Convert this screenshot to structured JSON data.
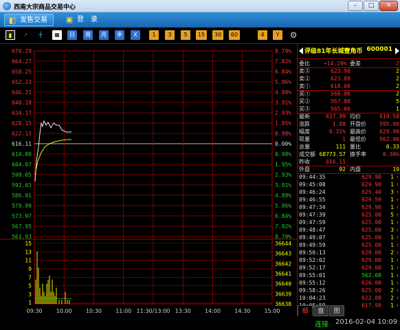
{
  "window": {
    "title": "西南大宗商品交易中心",
    "min": "–",
    "max": "□",
    "close": "✕"
  },
  "menu": [
    {
      "label": "发售交易",
      "icon": "🖥",
      "active": true
    },
    {
      "label": "登　录",
      "icon": "🔒",
      "active": false
    }
  ],
  "toolbar": {
    "period_buttons": [
      "日",
      "周",
      "月",
      "季",
      "X"
    ],
    "minute_buttons": [
      "1",
      "3",
      "5",
      "15",
      "30",
      "60",
      "4",
      "Y"
    ],
    "settings_icon": "gear-icon"
  },
  "chart": {
    "prices": [
      "670.29",
      "664.27",
      "658.25",
      "652.23",
      "646.21",
      "640.19",
      "634.17",
      "628.15",
      "622.13",
      "616.11",
      "610.09",
      "604.07",
      "598.05",
      "592.03",
      "586.01",
      "579.99",
      "573.97",
      "567.95",
      "561.93"
    ],
    "percents": [
      "8.79%",
      "7.82%",
      "6.84%",
      "5.86%",
      "4.89%",
      "3.91%",
      "2.93%",
      "1.95%",
      "0.98%",
      "0.00%",
      "0.98%",
      "1.95%",
      "2.93%",
      "3.91%",
      "4.89%",
      "5.86%",
      "6.84%",
      "7.82%",
      "8.79%"
    ],
    "vol_left": [
      "15",
      "13",
      "11",
      "9",
      "7",
      "5",
      "3",
      "1"
    ],
    "vol_right": [
      "36644",
      "36643",
      "36642",
      "36641",
      "36640",
      "36639",
      "36638"
    ],
    "time_labels": [
      "09:30",
      "10:00",
      "10:30",
      "11:00",
      "11:30/13:00",
      "13:30",
      "14:00",
      "14:30",
      "15:00"
    ],
    "colors": {
      "up": "#ff3333",
      "down": "#22cc22",
      "flat": "#dddddd",
      "grid": "#a00000"
    }
  },
  "quote": {
    "name": "评级81年长城壹角币",
    "code": "600001",
    "weibi_label": "委比",
    "weibi_value": "+14.29%",
    "weicha_label": "委差",
    "weicha_value": "2",
    "sells": [
      {
        "label": "卖③",
        "price": "623.90",
        "vol": "2"
      },
      {
        "label": "卖②",
        "price": "623.80",
        "vol": "2"
      },
      {
        "label": "卖①",
        "price": "618.00",
        "vol": "2"
      }
    ],
    "buys": [
      {
        "label": "买①",
        "price": "568.00",
        "vol": "2"
      },
      {
        "label": "买②",
        "price": "567.80",
        "vol": "5"
      },
      {
        "label": "买③",
        "price": "565.00",
        "vol": "1"
      }
    ],
    "stats": [
      {
        "l1": "最新",
        "v1": "617.99",
        "l2": "均价",
        "v2": "619.58"
      },
      {
        "l1": "涨跌",
        "v1": "1.88",
        "l2": "开盘价",
        "v2": "595.00"
      },
      {
        "l1": "幅度",
        "v1": "0.31%",
        "l2": "最高价",
        "v2": "629.99"
      },
      {
        "l1": "现量",
        "v1": "1",
        "l2": "最低价",
        "v2": "562.00"
      },
      {
        "l1": "总量",
        "v1": "111",
        "l2": "量比",
        "v2": "0.33"
      },
      {
        "l1": "成交额",
        "v1": "68773.57",
        "l2": "换手率",
        "v2": "0.30%"
      },
      {
        "l1": "昨收",
        "v1": "616.11",
        "l2": "",
        "v2": ""
      }
    ],
    "outer_label": "外盘",
    "outer_value": "92",
    "inner_label": "内盘",
    "inner_value": "19",
    "ticks": [
      {
        "t": "09:44:35",
        "p": "629.90",
        "v": "1"
      },
      {
        "t": "09:45:08",
        "p": "629.90",
        "v": "1"
      },
      {
        "t": "09:46:24",
        "p": "625.40",
        "v": "3"
      },
      {
        "t": "09:46:55",
        "p": "629.59",
        "v": "1"
      },
      {
        "t": "09:47:34",
        "p": "629.90",
        "v": "1"
      },
      {
        "t": "09:47:39",
        "p": "625.00",
        "v": "5"
      },
      {
        "t": "09:47:59",
        "p": "625.00",
        "v": "1"
      },
      {
        "t": "09:48:47",
        "p": "625.00",
        "v": "3"
      },
      {
        "t": "09:49:07",
        "p": "625.00",
        "v": "1"
      },
      {
        "t": "09:49:59",
        "p": "625.00",
        "v": "1"
      },
      {
        "t": "09:50:13",
        "p": "629.00",
        "v": "2"
      },
      {
        "t": "09:52:02",
        "p": "629.00",
        "v": "1"
      },
      {
        "t": "09:52:17",
        "p": "629.00",
        "v": "1"
      },
      {
        "t": "09:55:01",
        "p": "562.00",
        "v": "1"
      },
      {
        "t": "09:55:12",
        "p": "626.00",
        "v": "1"
      },
      {
        "t": "09:58:26",
        "p": "625.00",
        "v": "2"
      },
      {
        "t": "10:04:23",
        "p": "622.00",
        "v": "2"
      },
      {
        "t": "10:05:59",
        "p": "617.99",
        "v": "1"
      }
    ],
    "tabs": [
      "细",
      "盘",
      "图"
    ]
  },
  "status": {
    "connection": "连接",
    "datetime": "2016-02-04 10:09"
  }
}
